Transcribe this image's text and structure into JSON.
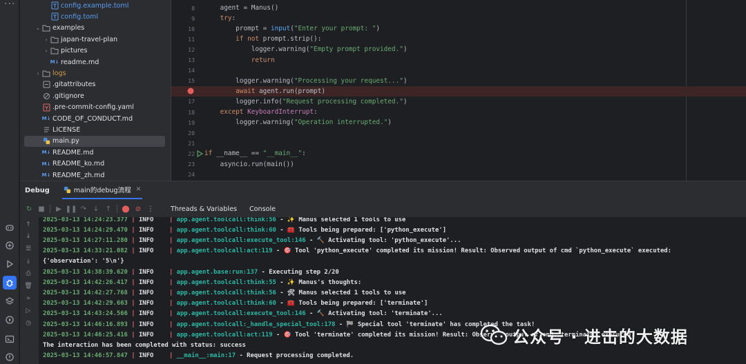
{
  "project_tree": {
    "items": [
      {
        "label": "config.example.toml",
        "icon": "toml-file-icon",
        "indent": 3,
        "chevron": "",
        "style": "toml"
      },
      {
        "label": "config.toml",
        "icon": "toml-file-icon",
        "indent": 3,
        "chevron": "",
        "style": "toml"
      },
      {
        "label": "examples",
        "icon": "folder-icon",
        "indent": 2,
        "chevron": "⌄",
        "style": ""
      },
      {
        "label": "japan-travel-plan",
        "icon": "folder-icon",
        "indent": 3,
        "chevron": "›",
        "style": ""
      },
      {
        "label": "pictures",
        "icon": "folder-icon",
        "indent": 3,
        "chevron": "›",
        "style": ""
      },
      {
        "label": "readme.md",
        "icon": "markdown-file-icon",
        "indent": 3,
        "chevron": "",
        "style": ""
      },
      {
        "label": "logs",
        "icon": "folder-icon",
        "indent": 2,
        "chevron": "›",
        "style": "logs"
      },
      {
        "label": ".gitattributes",
        "icon": "git-file-icon",
        "indent": 2,
        "chevron": "",
        "style": ""
      },
      {
        "label": ".gitignore",
        "icon": "ignore-file-icon",
        "indent": 2,
        "chevron": "",
        "style": ""
      },
      {
        "label": ".pre-commit-config.yaml",
        "icon": "yaml-file-icon",
        "indent": 2,
        "chevron": "",
        "style": ""
      },
      {
        "label": "CODE_OF_CONDUCT.md",
        "icon": "markdown-file-icon",
        "indent": 2,
        "chevron": "",
        "style": ""
      },
      {
        "label": "LICENSE",
        "icon": "text-file-icon",
        "indent": 2,
        "chevron": "",
        "style": ""
      },
      {
        "label": "main.py",
        "icon": "python-file-icon",
        "indent": 2,
        "chevron": "",
        "style": "",
        "selected": true
      },
      {
        "label": "README.md",
        "icon": "markdown-file-icon",
        "indent": 2,
        "chevron": "",
        "style": ""
      },
      {
        "label": "README_ko.md",
        "icon": "markdown-file-icon",
        "indent": 2,
        "chevron": "",
        "style": ""
      },
      {
        "label": "README_zh.md",
        "icon": "markdown-file-icon",
        "indent": 2,
        "chevron": "",
        "style": ""
      }
    ]
  },
  "editor": {
    "lines": [
      {
        "num": "8",
        "mark": "",
        "tokens": [
          [
            "plain",
            "    agent = Manus()"
          ]
        ]
      },
      {
        "num": "9",
        "mark": "",
        "tokens": [
          [
            "kw",
            "    try"
          ],
          [
            "plain",
            ":"
          ]
        ]
      },
      {
        "num": "10",
        "mark": "",
        "tokens": [
          [
            "plain",
            "        prompt = "
          ],
          [
            "fn",
            "input"
          ],
          [
            "plain",
            "("
          ],
          [
            "str",
            "\"Enter your prompt: \""
          ],
          [
            "plain",
            ")"
          ]
        ]
      },
      {
        "num": "11",
        "mark": "",
        "tokens": [
          [
            "kw",
            "        if not "
          ],
          [
            "plain",
            "prompt.strip():"
          ]
        ]
      },
      {
        "num": "12",
        "mark": "",
        "tokens": [
          [
            "plain",
            "            logger.warning("
          ],
          [
            "str",
            "\"Empty prompt provided.\""
          ],
          [
            "plain",
            ")"
          ]
        ]
      },
      {
        "num": "13",
        "mark": "",
        "tokens": [
          [
            "kw",
            "            return"
          ]
        ]
      },
      {
        "num": "14",
        "mark": "",
        "tokens": []
      },
      {
        "num": "15",
        "mark": "",
        "tokens": [
          [
            "plain",
            "        logger.warning("
          ],
          [
            "str",
            "\"Processing your request...\""
          ],
          [
            "plain",
            ")"
          ]
        ]
      },
      {
        "num": "",
        "mark": "breakpoint",
        "tokens": [
          [
            "kw",
            "        await "
          ],
          [
            "plain",
            "agent.run(prompt)"
          ]
        ]
      },
      {
        "num": "17",
        "mark": "",
        "tokens": [
          [
            "plain",
            "        logger.info("
          ],
          [
            "str",
            "\"Request processing completed.\""
          ],
          [
            "plain",
            ")"
          ]
        ]
      },
      {
        "num": "18",
        "mark": "",
        "tokens": [
          [
            "kw",
            "    except "
          ],
          [
            "cls",
            "KeyboardInterrupt"
          ],
          [
            "plain",
            ":"
          ]
        ]
      },
      {
        "num": "19",
        "mark": "",
        "tokens": [
          [
            "plain",
            "        logger.warning("
          ],
          [
            "str",
            "\"Operation interrupted.\""
          ],
          [
            "plain",
            ")"
          ]
        ]
      },
      {
        "num": "20",
        "mark": "",
        "tokens": []
      },
      {
        "num": "21",
        "mark": "",
        "tokens": []
      },
      {
        "num": "22",
        "mark": "run",
        "tokens": [
          [
            "kw",
            "if "
          ],
          [
            "plain",
            "__name__ == "
          ],
          [
            "str",
            "\"__main__\""
          ],
          [
            "plain",
            ":"
          ]
        ]
      },
      {
        "num": "23",
        "mark": "",
        "tokens": [
          [
            "plain",
            "    asyncio.run(main())"
          ]
        ]
      },
      {
        "num": "24",
        "mark": "",
        "tokens": []
      }
    ]
  },
  "debug": {
    "title": "Debug",
    "session_tab": "main的debug流程",
    "tabs": [
      "Threads & Variables",
      "Console"
    ]
  },
  "console": {
    "lines": [
      {
        "ts": "2025-03-13 14:24:23.377",
        "lvl": "INFO",
        "src": "app.agent.toolcall:think:56",
        "msg": " - ✨ Manus selected 1 tools to use"
      },
      {
        "ts": "2025-03-13 14:24:29.470",
        "lvl": "INFO",
        "src": "app.agent.toolcall:think:60",
        "msg": " - 🧰 Tools being prepared: ['python_execute']"
      },
      {
        "ts": "2025-03-13 14:27:11.280",
        "lvl": "INFO",
        "src": "app.agent.toolcall:execute_tool:146",
        "msg": " - 🔨 Activating tool: 'python_execute'..."
      },
      {
        "ts": "2025-03-13 14:33:21.082",
        "lvl": "INFO",
        "src": "app.agent.toolcall:act:119",
        "msg": " - 🎯 Tool 'python_execute' completed its mission! Result: Observed output of cmd `python_execute` executed:"
      },
      {
        "plain": "{'observation': '5\\n'}"
      },
      {
        "ts": "2025-03-13 14:38:39.620",
        "lvl": "INFO",
        "src": "app.agent.base:run:137",
        "msg": " - Executing step 2/20"
      },
      {
        "ts": "2025-03-13 14:42:26.417",
        "lvl": "INFO",
        "src": "app.agent.toolcall:think:55",
        "msg": " - ✨ Manus's thoughts:"
      },
      {
        "ts": "2025-03-13 14:42:27.768",
        "lvl": "INFO",
        "src": "app.agent.toolcall:think:56",
        "msg": " - 🛠 Manus selected 1 tools to use"
      },
      {
        "ts": "2025-03-13 14:42:29.663",
        "lvl": "INFO",
        "src": "app.agent.toolcall:think:60",
        "msg": " - 🧰 Tools being prepared: ['terminate']"
      },
      {
        "ts": "2025-03-13 14:43:24.566",
        "lvl": "INFO",
        "src": "app.agent.toolcall:execute_tool:146",
        "msg": " - 🔨 Activating tool: 'terminate'..."
      },
      {
        "ts": "2025-03-13 14:46:16.893",
        "lvl": "INFO",
        "src": "app.agent.toolcall:_handle_special_tool:178",
        "msg": " - 🏁 Special tool 'terminate' has completed the task!"
      },
      {
        "ts": "2025-03-13 14:46:25.416",
        "lvl": "INFO",
        "src": "app.agent.toolcall:act:119",
        "msg": " - 🎯 Tool 'terminate' completed its mission! Result: Observed output of cmd `terminate` executed:"
      },
      {
        "plain": "The interaction has been completed with status: success"
      },
      {
        "ts": "2025-03-13 14:46:57.847",
        "lvl": "INFO",
        "src": "__main__:main:17",
        "msg": " - Request processing completed."
      }
    ]
  },
  "watermark": {
    "text": "公众号 · 进击的大数据"
  },
  "colors": {
    "accent": "#3574f0",
    "breakpoint": "#e55e5e",
    "timestamp": "#6aab73",
    "source": "#2ab7a5"
  }
}
